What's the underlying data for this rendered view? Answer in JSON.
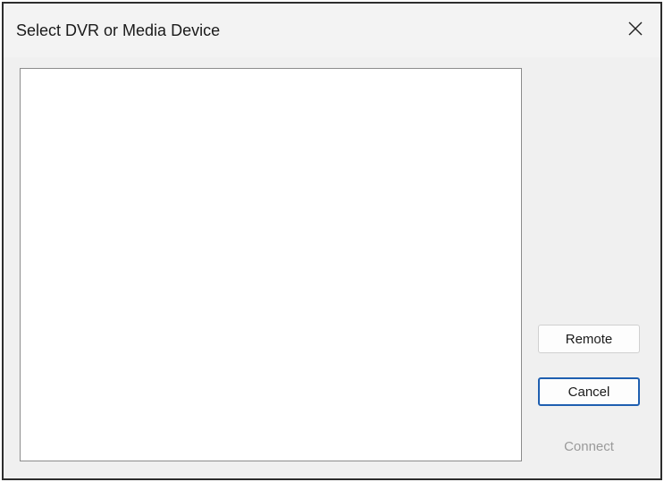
{
  "dialog": {
    "title": "Select DVR or Media Device",
    "close_icon": "close-icon"
  },
  "device_list": {
    "items": []
  },
  "buttons": {
    "remote_label": "Remote",
    "cancel_label": "Cancel",
    "connect_label": "Connect",
    "connect_enabled": false
  },
  "colors": {
    "focus_border": "#1f5fb0",
    "disabled_text": "#9a9a9a"
  }
}
